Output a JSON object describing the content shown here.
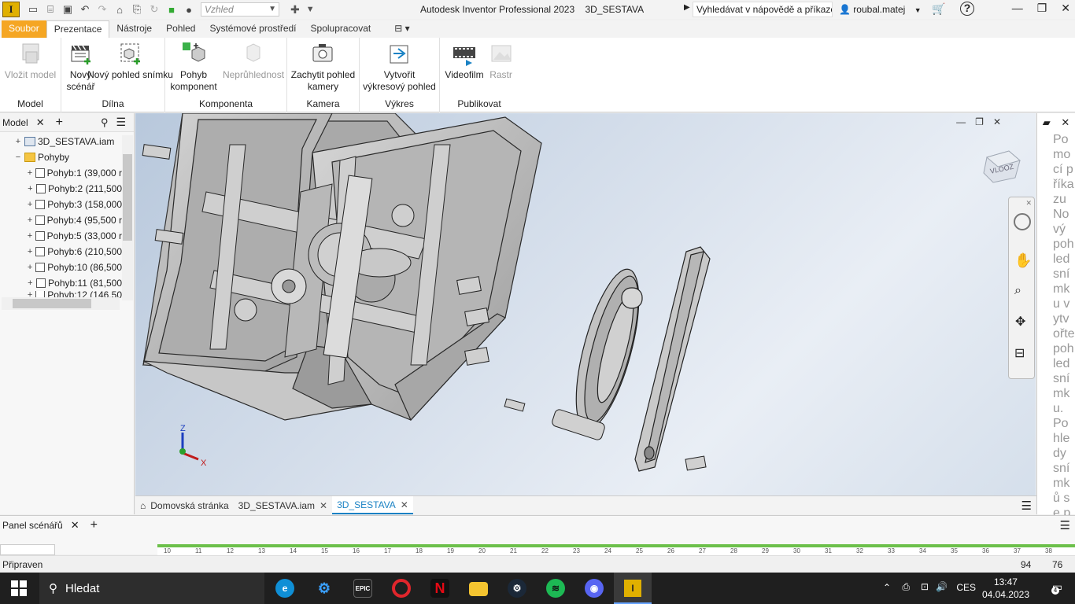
{
  "app": {
    "title": "Autodesk Inventor Professional 2023",
    "document": "3D_SESTAVA",
    "logo_letter": "I",
    "appearance_placeholder": "Vzhled",
    "help_search": "Vyhledávat v nápovědě a příkaze",
    "user": "roubal.matej"
  },
  "ribbon_tabs": [
    "Soubor",
    "Prezentace",
    "Nástroje",
    "Pohled",
    "Systémové prostředí",
    "Spolupracovat"
  ],
  "ribbon_groups": [
    {
      "title": "Model",
      "buttons": [
        {
          "label": "Vložit model",
          "disabled": true,
          "icon": "insert-model-icon"
        }
      ]
    },
    {
      "title": "Dílna",
      "buttons": [
        {
          "label": "Nový scénář",
          "icon": "new-storyboard-icon"
        },
        {
          "label": "Nový pohled snímku",
          "icon": "new-snapshot-icon"
        }
      ]
    },
    {
      "title": "Komponenta",
      "buttons": [
        {
          "label": "Pohyb komponent",
          "icon": "tweak-components-icon"
        },
        {
          "label": "Neprůhlednost",
          "disabled": true,
          "icon": "opacity-icon"
        }
      ]
    },
    {
      "title": "Kamera",
      "buttons": [
        {
          "label": "Zachytit pohled kamery",
          "icon": "capture-camera-icon"
        }
      ]
    },
    {
      "title": "Výkres",
      "buttons": [
        {
          "label": "Vytvořit výkresový pohled",
          "icon": "create-drawing-view-icon"
        }
      ]
    },
    {
      "title": "Publikovat",
      "buttons": [
        {
          "label": "Videofilm",
          "icon": "video-icon"
        },
        {
          "label": "Rastr",
          "disabled": true,
          "icon": "raster-icon"
        }
      ]
    }
  ],
  "browser": {
    "title": "Model",
    "items": [
      {
        "label": "3D_SESTAVA.iam",
        "expand": "+"
      },
      {
        "label": "Pohyby",
        "expand": "−"
      },
      {
        "label": "Pohyb:1 (39,000 r",
        "expand": "+"
      },
      {
        "label": "Pohyb:2 (211,500",
        "expand": "+"
      },
      {
        "label": "Pohyb:3 (158,000",
        "expand": "+"
      },
      {
        "label": "Pohyb:4 (95,500 r",
        "expand": "+"
      },
      {
        "label": "Pohyb:5 (33,000 r",
        "expand": "+"
      },
      {
        "label": "Pohyb:6 (210,500",
        "expand": "+"
      },
      {
        "label": "Pohyb:10 (86,500",
        "expand": "+"
      },
      {
        "label": "Pohyb:11 (81,500",
        "expand": "+"
      },
      {
        "label": "Pohyb:12 (146,50",
        "expand": "+"
      }
    ]
  },
  "viewcube_label": "VLOOZ",
  "axes": {
    "x": "X",
    "z": "Z"
  },
  "help_text": "Pomocí příkazu Nový pohled snímku vytvořte pohled snímku. Pohledy snímků se používají k",
  "doc_tabs": [
    "Domovská stránka",
    "3D_SESTAVA.iam",
    "3D_SESTAVA"
  ],
  "scene_panel": {
    "title": "Panel scénářů",
    "ticks": [
      10,
      11,
      12,
      13,
      14,
      15,
      16,
      17,
      18,
      19,
      20,
      21,
      22,
      23,
      24,
      25,
      26,
      27,
      28,
      29,
      30,
      31,
      32,
      33,
      34,
      35,
      36,
      37,
      38
    ]
  },
  "status": {
    "text": "Připraven",
    "n1": "94",
    "n2": "76"
  },
  "taskbar": {
    "search": "Hledat",
    "lang": "CES",
    "time": "13:47",
    "date": "04.04.2023",
    "notifications": "4"
  }
}
